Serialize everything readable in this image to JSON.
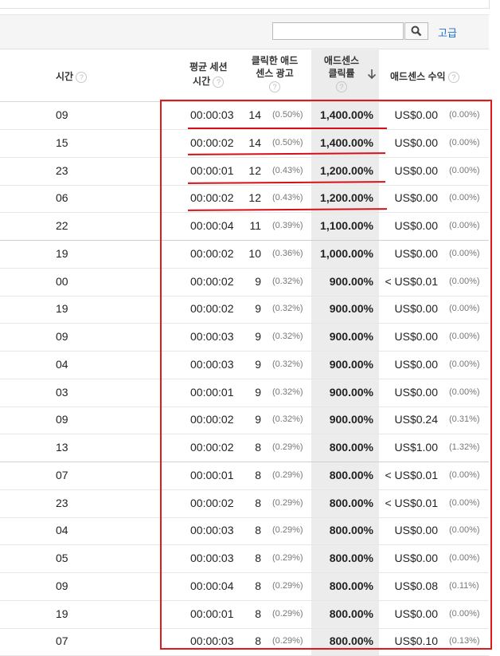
{
  "toolbar": {
    "search_value": "",
    "advanced_label": "고급"
  },
  "columns": {
    "hour": "시간",
    "avg_session_line1": "평균 세션",
    "avg_session_line2": "시간",
    "clicked_ads_line1": "클릭한 애드",
    "clicked_ads_line2": "센스 광고",
    "ctr_line1": "애드센스",
    "ctr_line2": "클릭률",
    "revenue": "애드센스 수익"
  },
  "rows": [
    {
      "hour": "09",
      "dur": "00:00:03",
      "clicks": "14",
      "clickpct": "(0.50%)",
      "ctr": "1,400.00%",
      "rev": "US$0.00",
      "revpct": "(0.00%)"
    },
    {
      "hour": "15",
      "dur": "00:00:02",
      "clicks": "14",
      "clickpct": "(0.50%)",
      "ctr": "1,400.00%",
      "rev": "US$0.00",
      "revpct": "(0.00%)"
    },
    {
      "hour": "23",
      "dur": "00:00:01",
      "clicks": "12",
      "clickpct": "(0.43%)",
      "ctr": "1,200.00%",
      "rev": "US$0.00",
      "revpct": "(0.00%)"
    },
    {
      "hour": "06",
      "dur": "00:00:02",
      "clicks": "12",
      "clickpct": "(0.43%)",
      "ctr": "1,200.00%",
      "rev": "US$0.00",
      "revpct": "(0.00%)"
    },
    {
      "hour": "22",
      "dur": "00:00:04",
      "clicks": "11",
      "clickpct": "(0.39%)",
      "ctr": "1,100.00%",
      "rev": "US$0.00",
      "revpct": "(0.00%)"
    },
    {
      "hour": "19",
      "dur": "00:00:02",
      "clicks": "10",
      "clickpct": "(0.36%)",
      "ctr": "1,000.00%",
      "rev": "US$0.00",
      "revpct": "(0.00%)"
    },
    {
      "hour": "00",
      "dur": "00:00:02",
      "clicks": "9",
      "clickpct": "(0.32%)",
      "ctr": "900.00%",
      "rev": "< US$0.01",
      "revpct": "(0.00%)"
    },
    {
      "hour": "19",
      "dur": "00:00:02",
      "clicks": "9",
      "clickpct": "(0.32%)",
      "ctr": "900.00%",
      "rev": "US$0.00",
      "revpct": "(0.00%)"
    },
    {
      "hour": "09",
      "dur": "00:00:03",
      "clicks": "9",
      "clickpct": "(0.32%)",
      "ctr": "900.00%",
      "rev": "US$0.00",
      "revpct": "(0.00%)"
    },
    {
      "hour": "04",
      "dur": "00:00:03",
      "clicks": "9",
      "clickpct": "(0.32%)",
      "ctr": "900.00%",
      "rev": "US$0.00",
      "revpct": "(0.00%)"
    },
    {
      "hour": "03",
      "dur": "00:00:01",
      "clicks": "9",
      "clickpct": "(0.32%)",
      "ctr": "900.00%",
      "rev": "US$0.00",
      "revpct": "(0.00%)"
    },
    {
      "hour": "09",
      "dur": "00:00:02",
      "clicks": "9",
      "clickpct": "(0.32%)",
      "ctr": "900.00%",
      "rev": "US$0.24",
      "revpct": "(0.31%)"
    },
    {
      "hour": "13",
      "dur": "00:00:02",
      "clicks": "8",
      "clickpct": "(0.29%)",
      "ctr": "800.00%",
      "rev": "US$1.00",
      "revpct": "(1.32%)"
    },
    {
      "hour": "07",
      "dur": "00:00:01",
      "clicks": "8",
      "clickpct": "(0.29%)",
      "ctr": "800.00%",
      "rev": "< US$0.01",
      "revpct": "(0.00%)"
    },
    {
      "hour": "23",
      "dur": "00:00:02",
      "clicks": "8",
      "clickpct": "(0.29%)",
      "ctr": "800.00%",
      "rev": "< US$0.01",
      "revpct": "(0.00%)"
    },
    {
      "hour": "04",
      "dur": "00:00:03",
      "clicks": "8",
      "clickpct": "(0.29%)",
      "ctr": "800.00%",
      "rev": "US$0.00",
      "revpct": "(0.00%)"
    },
    {
      "hour": "05",
      "dur": "00:00:03",
      "clicks": "8",
      "clickpct": "(0.29%)",
      "ctr": "800.00%",
      "rev": "US$0.00",
      "revpct": "(0.00%)"
    },
    {
      "hour": "09",
      "dur": "00:00:04",
      "clicks": "8",
      "clickpct": "(0.29%)",
      "ctr": "800.00%",
      "rev": "US$0.08",
      "revpct": "(0.11%)"
    },
    {
      "hour": "19",
      "dur": "00:00:01",
      "clicks": "8",
      "clickpct": "(0.29%)",
      "ctr": "800.00%",
      "rev": "US$0.00",
      "revpct": "(0.00%)"
    },
    {
      "hour": "07",
      "dur": "00:00:03",
      "clicks": "8",
      "clickpct": "(0.29%)",
      "ctr": "800.00%",
      "rev": "US$0.10",
      "revpct": "(0.13%)"
    }
  ],
  "colors": {
    "annotation_red": "#e01a1a",
    "link_blue": "#1a73c8",
    "sorted_column_bg": "#ececec"
  },
  "icons": {
    "search": "search-icon",
    "help": "help-icon",
    "sort": "sort-down-arrow-icon"
  }
}
